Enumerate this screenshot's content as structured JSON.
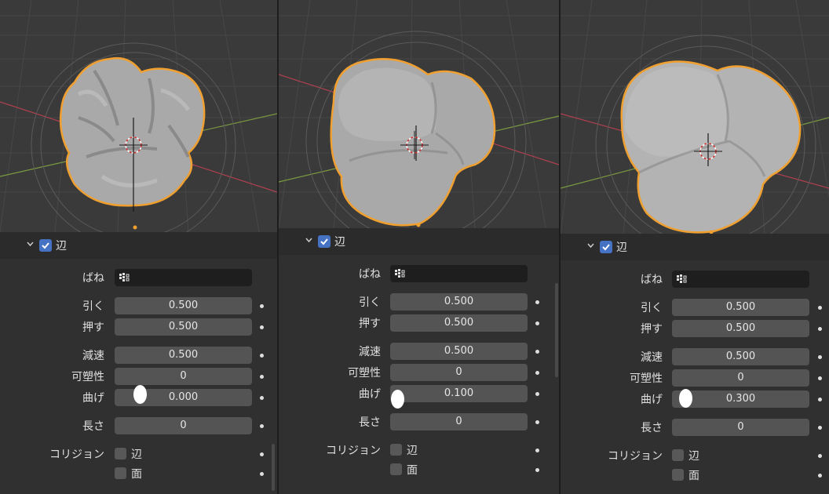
{
  "panels": [
    {
      "section_title": "辺",
      "spring_label": "ばね",
      "tension_label": "引く",
      "tension_value": "0.500",
      "compression_label": "押す",
      "compression_value": "0.500",
      "damping_label": "減速",
      "damping_value": "0.500",
      "plasticity_label": "可塑性",
      "plasticity_value": "0",
      "bending_label": "曲げ",
      "bending_value": "0.000",
      "length_label": "長さ",
      "length_value": "0",
      "collision_label": "コリジョン",
      "collision_edge_label": "辺",
      "collision_face_label": "面"
    },
    {
      "section_title": "辺",
      "spring_label": "ばね",
      "tension_label": "引く",
      "tension_value": "0.500",
      "compression_label": "押す",
      "compression_value": "0.500",
      "damping_label": "減速",
      "damping_value": "0.500",
      "plasticity_label": "可塑性",
      "plasticity_value": "0",
      "bending_label": "曲げ",
      "bending_value": "0.100",
      "length_label": "長さ",
      "length_value": "0",
      "collision_label": "コリジョン",
      "collision_edge_label": "辺",
      "collision_face_label": "面"
    },
    {
      "section_title": "辺",
      "spring_label": "ばね",
      "tension_label": "引く",
      "tension_value": "0.500",
      "compression_label": "押す",
      "compression_value": "0.500",
      "damping_label": "減速",
      "damping_value": "0.500",
      "plasticity_label": "可塑性",
      "plasticity_value": "0",
      "bending_label": "曲げ",
      "bending_value": "0.300",
      "length_label": "長さ",
      "length_value": "0",
      "collision_label": "コリジョン",
      "collision_edge_label": "辺",
      "collision_face_label": "面"
    }
  ],
  "colors": {
    "checkbox_blue": "#4672c4",
    "selection_outline": "#f0a030",
    "axis_red": "#b04050",
    "axis_green": "#7a9a40"
  }
}
